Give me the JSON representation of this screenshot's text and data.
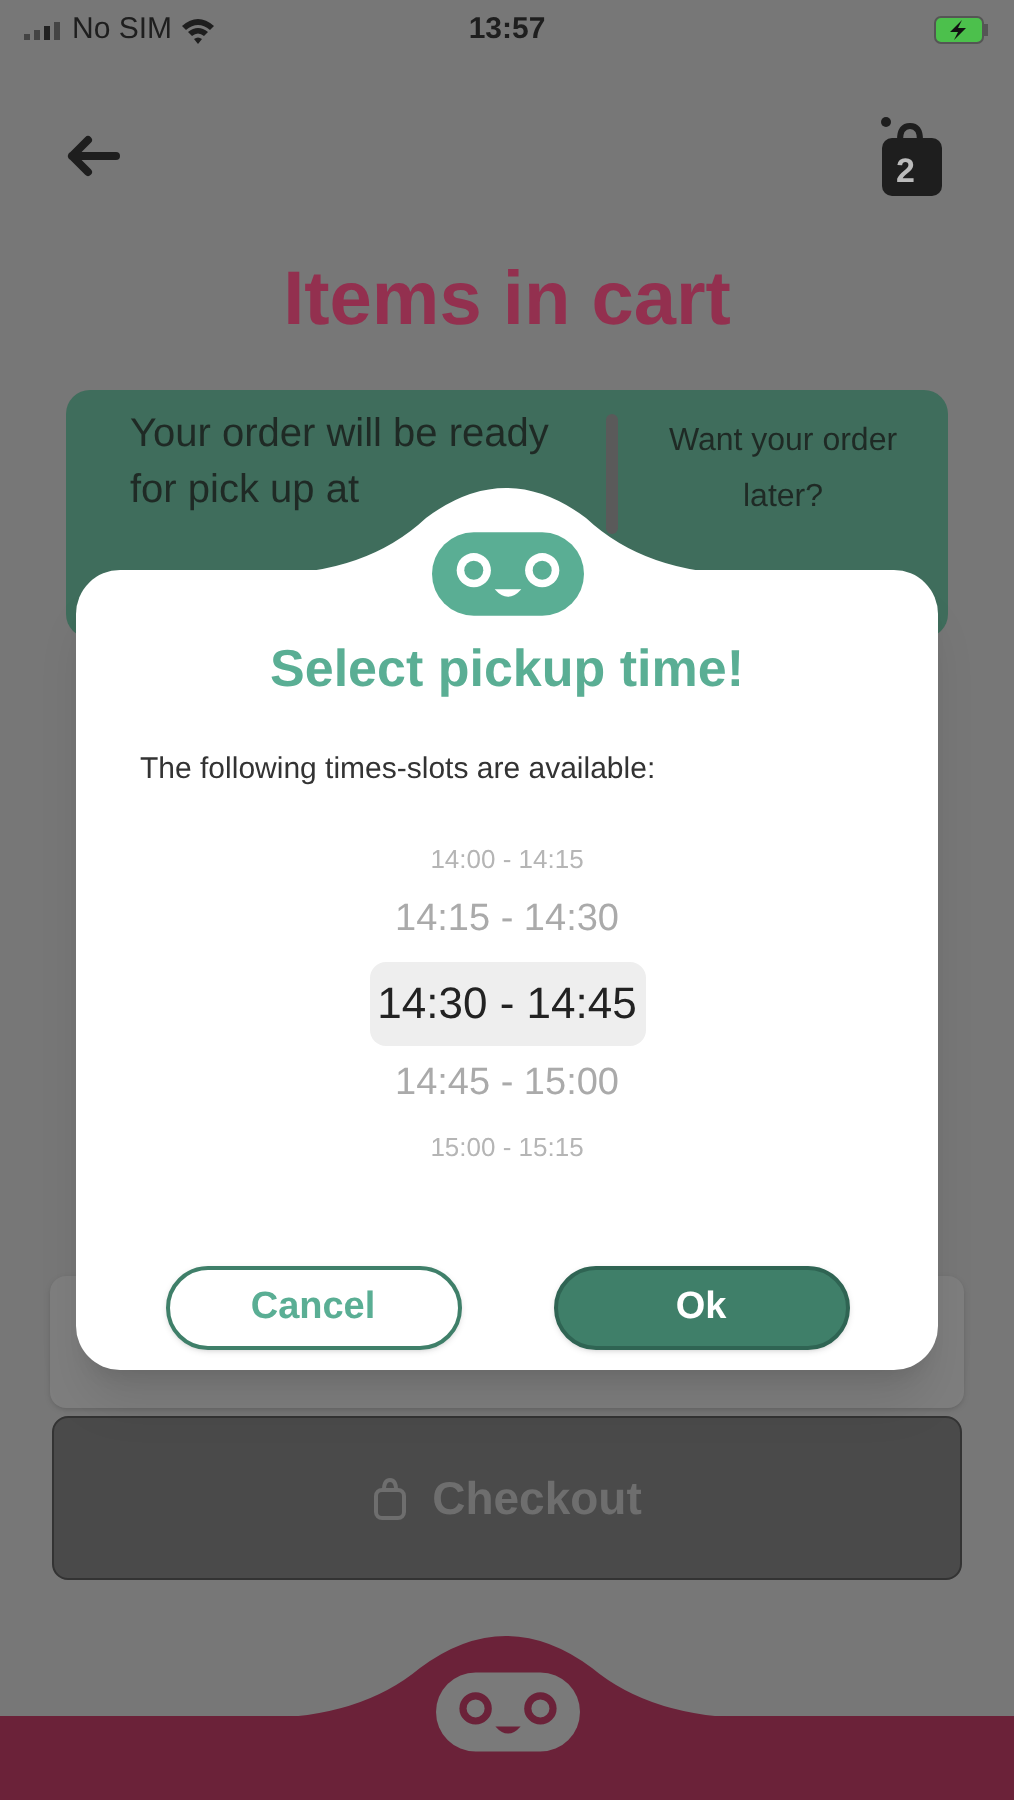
{
  "status_bar": {
    "carrier": "No SIM",
    "time": "13:57"
  },
  "header": {
    "cart_count": "2"
  },
  "title": "Items in cart",
  "pickup_card": {
    "message": "Your order will be ready for pick up at",
    "later_prompt": "Want your order later?"
  },
  "checkout_button": {
    "label": "Checkout",
    "disabled": true
  },
  "dialog": {
    "title": "Select pickup time!",
    "subtitle": "The following times-slots are available:",
    "slots": [
      {
        "label": "14:00 - 14:15",
        "selected": false
      },
      {
        "label": "14:15 - 14:30",
        "selected": false
      },
      {
        "label": "14:30 - 14:45",
        "selected": true
      },
      {
        "label": "14:45 - 15:00",
        "selected": false
      },
      {
        "label": "15:00 - 15:15",
        "selected": false
      }
    ],
    "buttons": [
      {
        "label": "Cancel",
        "kind": "secondary"
      },
      {
        "label": "Ok",
        "kind": "primary"
      }
    ]
  }
}
